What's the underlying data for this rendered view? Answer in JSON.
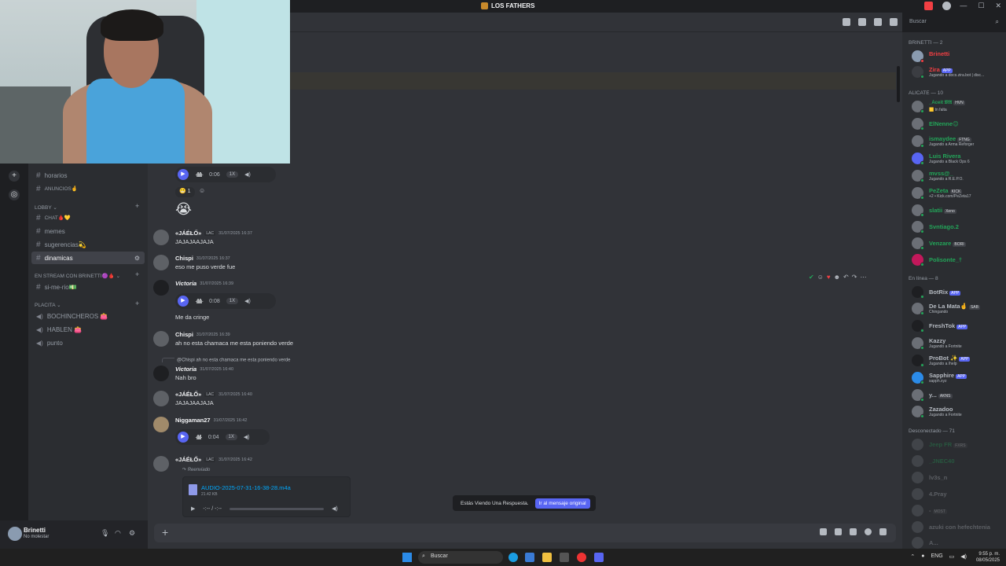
{
  "window": {
    "title": "LOS FATHERS"
  },
  "search": {
    "placeholder": "Buscar"
  },
  "channels": {
    "items": [
      {
        "label": "horarios"
      },
      {
        "label": "ANUNCIOS🤞"
      },
      {
        "label": "CHAT🩸💛"
      },
      {
        "label": "memes"
      },
      {
        "label": "sugerencias💫"
      },
      {
        "label": "dinamicas"
      },
      {
        "label": "si-me-rio💵"
      }
    ],
    "categories": {
      "lobby": "LOBBY",
      "stream": "EN STREAM CON BRINETTI🟣🩸",
      "placita": "PLACITA"
    },
    "voice": [
      {
        "label": "BOCHINCHEROS 👛"
      },
      {
        "label": "HABLEN 👛"
      },
      {
        "label": "punto"
      }
    ]
  },
  "user_panel": {
    "name": "Brinetti",
    "status": "No molestar"
  },
  "messages": {
    "m0_voice": {
      "duration": "0:06",
      "rate": "1X"
    },
    "reaction_count": "1",
    "m1": {
      "name": "«JÁÉŁŐ»",
      "tag": "LAC",
      "time": "31/07/2025 16:37",
      "text": "JAJAJAAJAJA"
    },
    "m2": {
      "name": "Chispi",
      "time": "31/07/2025 16:37",
      "text": "eso me puso verde fue"
    },
    "m3": {
      "name": "Victoria",
      "time": "31/07/2025 16:39",
      "voice_duration": "0:08",
      "rate": "1X",
      "text": "Me da cringe"
    },
    "m4": {
      "name": "Chispi",
      "time": "31/07/2025 16:39",
      "text": "ah no esta chamaca me esta poniendo verde"
    },
    "reply": "@Chispi ah no esta chamaca me esta poniendo verde",
    "m5": {
      "name": "Victoria",
      "time": "31/07/2025 16:40",
      "text": "Nah bro"
    },
    "m6": {
      "name": "«JÁÉŁŐ»",
      "tag": "LAC",
      "time": "31/07/2025 16:40",
      "text": "JAJAJAAJAJA"
    },
    "m7": {
      "name": "Niggaman27",
      "time": "31/07/2025 16:42",
      "voice_duration": "0:04",
      "rate": "1X"
    },
    "m8": {
      "name": "«JÁÉŁŐ»",
      "tag": "LAC",
      "time": "31/07/2025 16:42",
      "forwarded": "Reenviado"
    },
    "file": {
      "name": "AUDIO-2025-07-31-16-38-28.m4a",
      "size": "21.42 KB",
      "time": "-:-- / -:--"
    }
  },
  "toast": {
    "text": "Estás Viendo Una Respuesta.",
    "button": "Ir al mensaje original"
  },
  "members": {
    "cat_brinetti": "BRINETTI — 2",
    "cat_alicate": "ALICATE — 10",
    "cat_online": "En línea — 8",
    "cat_offline": "Desconectado — 71",
    "brinetti": [
      {
        "name": "Brinetti",
        "status": "",
        "color": "#f23f43"
      },
      {
        "name": "Zira",
        "badge": "APP",
        "status": "Jugando a docs.zira.bot | disc...",
        "color": "#f23f43"
      }
    ],
    "alicate": [
      {
        "name": "_Aceit 𝔐𝔄",
        "badge": "HVN",
        "status": "🟨 tn falta",
        "color": "#23a559"
      },
      {
        "name": "ElNenne😊",
        "badge": "",
        "status": "",
        "color": "#23a559"
      },
      {
        "name": "ismaydee",
        "badge": "FTNG",
        "status": "Jugando a Arma Reforger",
        "color": "#23a559"
      },
      {
        "name": "Luis Rivera",
        "badge": "",
        "status": "Jugando a Black Ops 6",
        "color": "#23a559"
      },
      {
        "name": "mvss@_",
        "badge": "",
        "status": "Jugando a R.E.P.O.",
        "color": "#23a559"
      },
      {
        "name": "PeZeta",
        "badge": "KICK",
        "status": "+2 • Kick.com/PeZeta17",
        "color": "#23a559"
      },
      {
        "name": "slatii",
        "badge": "Xeno",
        "status": "",
        "color": "#23a559"
      },
      {
        "name": "Svntiago.2",
        "badge": "",
        "status": "",
        "color": "#23a559"
      },
      {
        "name": "Venzare",
        "badge": "BORI",
        "status": "",
        "color": "#23a559"
      },
      {
        "name": "Polisonte_†",
        "badge": "",
        "status": "",
        "color": "#23a559"
      }
    ],
    "online": [
      {
        "name": "BotRix",
        "badge": "APP",
        "status": ""
      },
      {
        "name": "De La Mata🤞",
        "badge": "SAB",
        "status": "Chingando"
      },
      {
        "name": "FreshTok",
        "badge": "APP",
        "status": ""
      },
      {
        "name": "Kazzy",
        "badge": "",
        "status": "Jugando a Fortnite"
      },
      {
        "name": "ProBot ✨",
        "badge": "APP",
        "status": "Jugando a /help"
      },
      {
        "name": "Sapphire",
        "badge": "APP",
        "status": "sapph.xyz"
      },
      {
        "name": "y...",
        "badge": "AKNS",
        "status": ""
      },
      {
        "name": "Zazadoo",
        "badge": "",
        "status": "Jugando a Fortnite"
      }
    ],
    "offline": [
      {
        "name": "Jeep FR",
        "badge": "FXRS"
      },
      {
        "name": "_JNEC40"
      },
      {
        "name": "lv3s_n"
      },
      {
        "name": "4.Pray"
      },
      {
        "name": "-",
        "badge": "MOST"
      },
      {
        "name": "azuki con hefechtenia"
      },
      {
        "name": "A..."
      }
    ]
  },
  "taskbar": {
    "search": "Buscar",
    "lang": "ENG",
    "time": "9:55 p. m.",
    "date": "08/05/2025"
  }
}
